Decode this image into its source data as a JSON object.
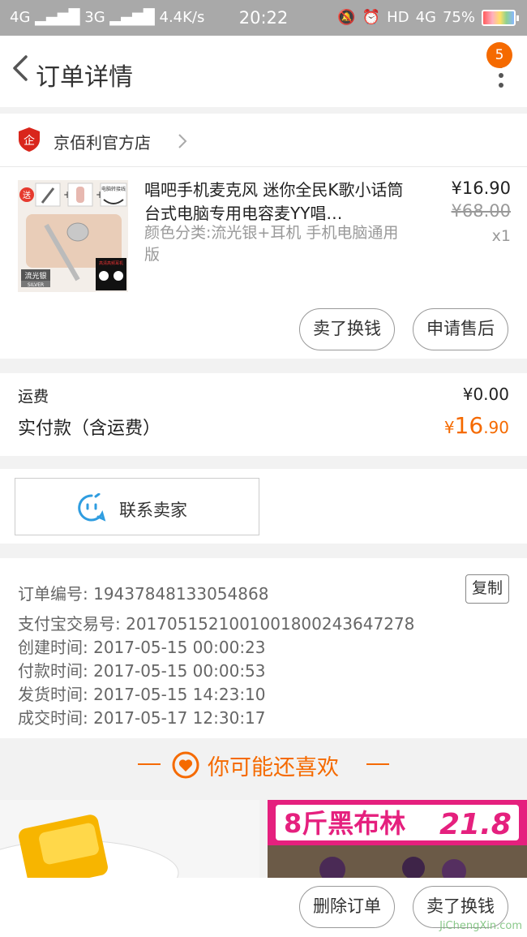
{
  "status_bar": {
    "signal_left": "4G",
    "signal_right": "3G",
    "speed": "4.4K/s",
    "time": "20:22",
    "network": "HD",
    "network_type": "4G",
    "battery": "75%"
  },
  "nav": {
    "title": "订单详情",
    "badge_count": "5"
  },
  "shop": {
    "name": "京佰利官方店",
    "logo_char": "企"
  },
  "item": {
    "title": "唱吧手机麦克风 迷你全民K歌小话筒台式电脑专用电容麦YY唱…",
    "spec": "颜色分类:流光银+耳机 手机电脑通用版",
    "price": "¥16.90",
    "orig_price": "¥68.00",
    "qty": "x1",
    "thumb": {
      "tag_gift": "送",
      "tag_silver": "流光银",
      "tag_silver_en": "SILVER",
      "tag_cable": "电脑转接线",
      "tag_earphone": "高清高频耳机"
    },
    "btn_exchange": "卖了换钱",
    "btn_aftersale": "申请售后"
  },
  "summary": {
    "shipping_label": "运费",
    "shipping_value": "¥0.00",
    "paid_label": "实付款（含运费）",
    "paid_currency": "¥",
    "paid_int": "16",
    "paid_dec": ".90"
  },
  "contact": {
    "label": "联系卖家"
  },
  "info": {
    "order_no": "订单编号: 19437848133054868",
    "copy_label": "复制",
    "alipay_no": "支付宝交易号: 2017051521001001800243647278",
    "created": "创建时间: 2017-05-15 00:00:23",
    "paid": "付款时间: 2017-05-15 00:00:53",
    "shipped": "发货时间: 2017-05-15 14:23:10",
    "closed": "成交时间: 2017-05-17 12:30:17"
  },
  "recommend": {
    "title": "你可能还喜欢",
    "product2_text": "8斤黑布林",
    "product2_price": "21.8"
  },
  "bottom": {
    "delete_label": "删除订单",
    "exchange_label": "卖了换钱",
    "watermark": "JiChengXin.com"
  },
  "colors": {
    "accent": "#f56a00",
    "statusbar": "#a9a9a9"
  }
}
